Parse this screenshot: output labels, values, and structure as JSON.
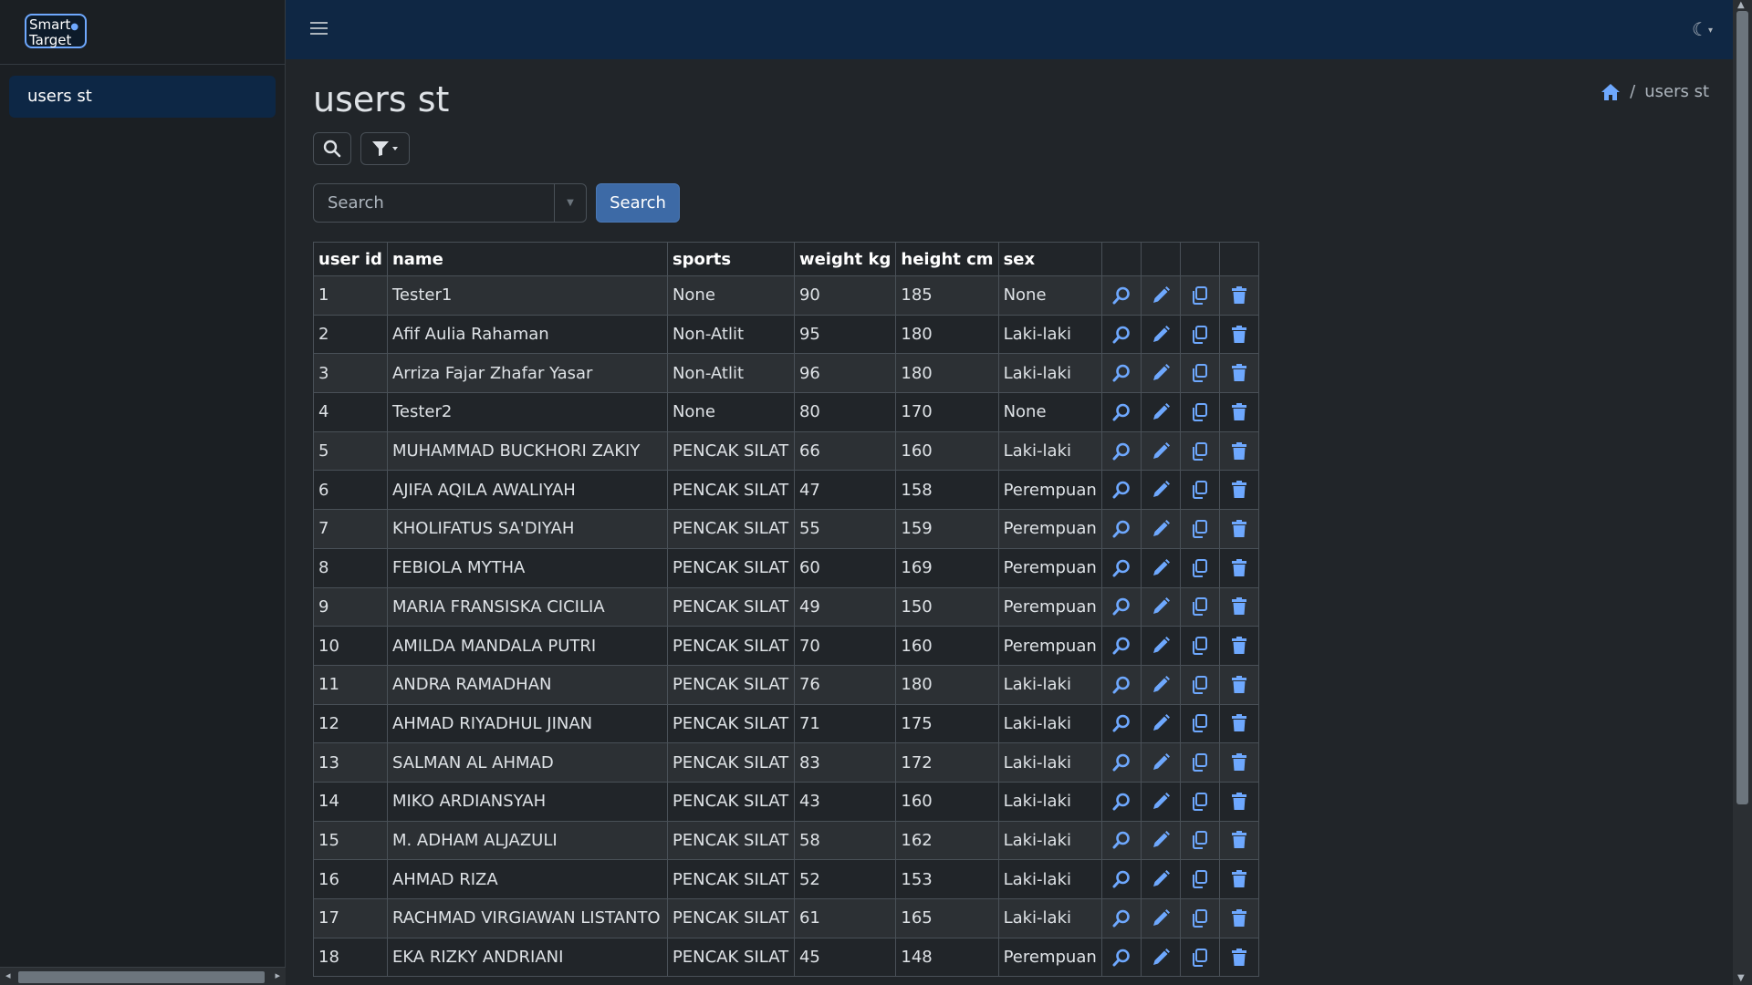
{
  "brand": {
    "line1": "Smart",
    "line2": "Target"
  },
  "sidebar": {
    "items": [
      {
        "label": "users st"
      }
    ]
  },
  "header": {
    "theme_icon": "moon-icon"
  },
  "page": {
    "title": "users st"
  },
  "breadcrumb": {
    "current": "users st"
  },
  "search": {
    "placeholder": "Search",
    "button_label": "Search"
  },
  "colors": {
    "accent": "#3d6aa6",
    "icon": "#6ea8fe",
    "topbar": "#0f2744"
  },
  "table": {
    "columns": [
      "user id",
      "name",
      "sports",
      "weight kg",
      "height cm",
      "sex"
    ],
    "rows": [
      [
        "1",
        "Tester1",
        "None",
        "90",
        "185",
        "None"
      ],
      [
        "2",
        "Afif Aulia Rahaman",
        "Non-Atlit",
        "95",
        "180",
        "Laki-laki"
      ],
      [
        "3",
        "Arriza Fajar Zhafar Yasar",
        "Non-Atlit",
        "96",
        "180",
        "Laki-laki"
      ],
      [
        "4",
        "Tester2",
        "None",
        "80",
        "170",
        "None"
      ],
      [
        "5",
        "MUHAMMAD BUCKHORI ZAKIY",
        "PENCAK SILAT",
        "66",
        "160",
        "Laki-laki"
      ],
      [
        "6",
        "AJIFA AQILA AWALIYAH",
        "PENCAK SILAT",
        "47",
        "158",
        "Perempuan"
      ],
      [
        "7",
        "KHOLIFATUS SA'DIYAH",
        "PENCAK SILAT",
        "55",
        "159",
        "Perempuan"
      ],
      [
        "8",
        "FEBIOLA MYTHA",
        "PENCAK SILAT",
        "60",
        "169",
        "Perempuan"
      ],
      [
        "9",
        "MARIA FRANSISKA CICILIA",
        "PENCAK SILAT",
        "49",
        "150",
        "Perempuan"
      ],
      [
        "10",
        "AMILDA MANDALA PUTRI",
        "PENCAK SILAT",
        "70",
        "160",
        "Perempuan"
      ],
      [
        "11",
        "ANDRA RAMADHAN",
        "PENCAK SILAT",
        "76",
        "180",
        "Laki-laki"
      ],
      [
        "12",
        "AHMAD RIYADHUL JINAN",
        "PENCAK SILAT",
        "71",
        "175",
        "Laki-laki"
      ],
      [
        "13",
        "SALMAN AL AHMAD",
        "PENCAK SILAT",
        "83",
        "172",
        "Laki-laki"
      ],
      [
        "14",
        "MIKO ARDIANSYAH",
        "PENCAK SILAT",
        "43",
        "160",
        "Laki-laki"
      ],
      [
        "15",
        "M. ADHAM ALJAZULI",
        "PENCAK SILAT",
        "58",
        "162",
        "Laki-laki"
      ],
      [
        "16",
        "AHMAD RIZA",
        "PENCAK SILAT",
        "52",
        "153",
        "Laki-laki"
      ],
      [
        "17",
        "RACHMAD VIRGIAWAN LISTANTO",
        "PENCAK SILAT",
        "61",
        "165",
        "Laki-laki"
      ],
      [
        "18",
        "EKA RIZKY ANDRIANI",
        "PENCAK SILAT",
        "45",
        "148",
        "Perempuan"
      ]
    ],
    "row_actions": [
      "view-icon",
      "edit-icon",
      "copy-icon",
      "delete-icon"
    ]
  }
}
